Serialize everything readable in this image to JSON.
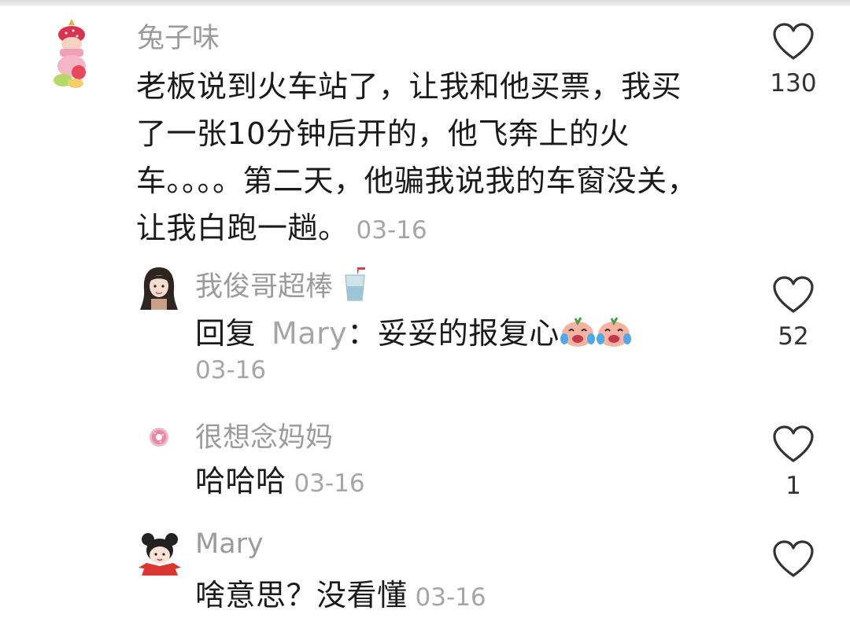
{
  "comments": [
    {
      "username": "兔子味",
      "text": "老板说到火车站了，让我和他买票，我买了一张10分钟后开的，他飞奔上的火车。。。。第二天，他骗我说我的车窗没关，让我白跑一趟。",
      "date": "03-16",
      "likes": "130",
      "avatar_icon": "strawberry-girl-avatar"
    },
    {
      "username": "我俊哥超棒",
      "username_emoji": "drink-cup-emoji",
      "reply_prefix": "回复",
      "reply_to": "Mary",
      "reply_colon": "：",
      "text": "妥妥的报复心",
      "text_emojis": [
        "laughing-crying-emoji",
        "laughing-crying-emoji"
      ],
      "date": "03-16",
      "likes": "52",
      "avatar_icon": "long-hair-girl-avatar"
    },
    {
      "username": "很想念妈妈",
      "text": "哈哈哈",
      "date": "03-16",
      "likes": "1",
      "avatar_icon": "donut-avatar"
    },
    {
      "username": "Mary",
      "text": "啥意思？没看懂",
      "date": "03-16",
      "likes": "",
      "avatar_icon": "bun-hair-girl-avatar"
    }
  ],
  "colors": {
    "username": "#9b9b9b",
    "text": "#1a1a1a",
    "date": "#a6a6a6",
    "heart_stroke": "#333333"
  }
}
